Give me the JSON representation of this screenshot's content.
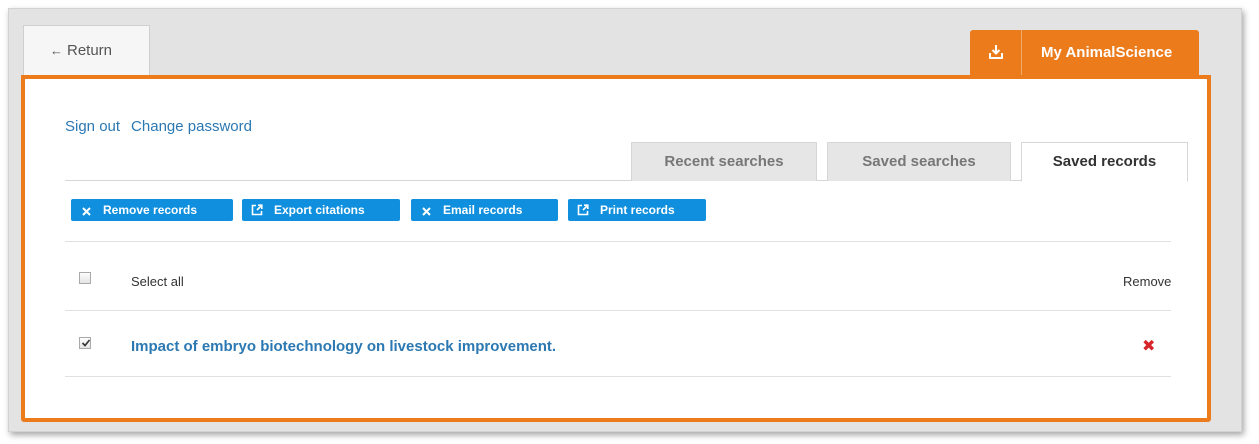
{
  "header": {
    "return_label": "Return",
    "return_arrow": "←",
    "my_tab_label": "My AnimalScience",
    "my_tab_icon": "download-tray-icon"
  },
  "account_links": {
    "sign_out": "Sign out",
    "change_password": "Change password"
  },
  "tabs": [
    {
      "label": "Recent searches",
      "active": false
    },
    {
      "label": "Saved searches",
      "active": false
    },
    {
      "label": "Saved records",
      "active": true
    }
  ],
  "actions": [
    {
      "label": "Remove records",
      "icon": "x-icon"
    },
    {
      "label": "Export citations",
      "icon": "export-icon"
    },
    {
      "label": "Email records",
      "icon": "x-icon"
    },
    {
      "label": "Print records",
      "icon": "export-icon"
    }
  ],
  "list": {
    "select_all_label": "Select all",
    "remove_header": "Remove",
    "records": [
      {
        "title": "Impact of embryo biotechnology on livestock improvement.",
        "checked": true,
        "remove_glyph": "✖"
      }
    ]
  },
  "colors": {
    "accent_orange": "#ec7b1b",
    "button_blue": "#0f8fdd",
    "link_blue": "#2b78b2",
    "remove_red": "#d6252a"
  }
}
